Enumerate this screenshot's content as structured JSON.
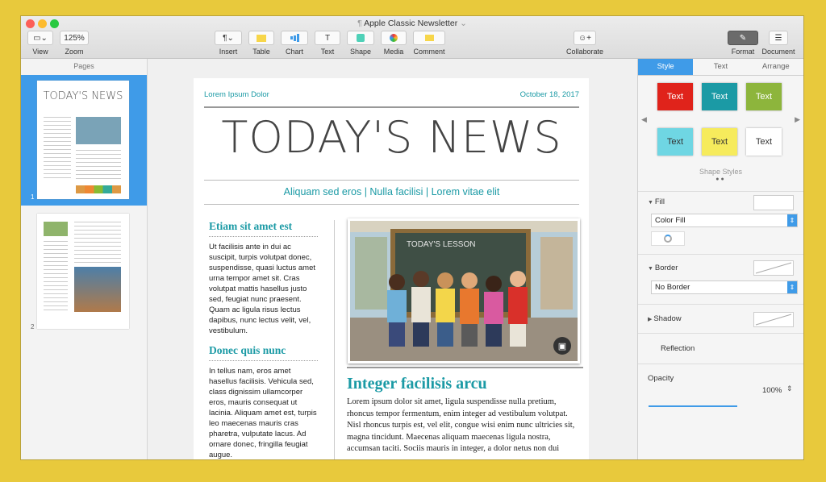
{
  "window": {
    "title": "Apple Classic Newsletter"
  },
  "toolbar": {
    "view_label": "View",
    "zoom_value": "125%",
    "zoom_label": "Zoom",
    "insert_label": "Insert",
    "table_label": "Table",
    "chart_label": "Chart",
    "text_label": "Text",
    "shape_label": "Shape",
    "media_label": "Media",
    "comment_label": "Comment",
    "collaborate_label": "Collaborate",
    "format_label": "Format",
    "document_label": "Document"
  },
  "sidebar": {
    "title": "Pages",
    "pages": [
      {
        "number": "1",
        "thumb_title": "TODAY'S NEWS"
      },
      {
        "number": "2"
      }
    ]
  },
  "document": {
    "header_left": "Lorem Ipsum Dolor",
    "header_right": "October 18, 2017",
    "headline": "TODAY'S NEWS",
    "tagline": "Aliquam sed eros | Nulla facilisi | Lorem vitae elit",
    "section1_title": "Etiam sit amet est",
    "section1_body": "Ut facilisis ante in dui ac suscipit, turpis volutpat donec, suspendisse, quasi luctus amet urna tempor amet sit. Cras volutpat mattis hasellus justo sed, feugiat nunc praesent. Quam ac ligula risus lectus dapibus, nunc lectus velit, vel, vestibulum.",
    "section2_title": "Donec quis nunc",
    "section2_body": "In tellus nam, eros amet hasellus facilisis. Vehicula sed, class dignissim ullamcorper eros, mauris consequat ut lacinia. Aliquam amet est, turpis leo maecenas mauris cras pharetra, vulputate lacus. Ad ornare donec, fringilla feugiat augue.",
    "feature_title": "Integer facilisis arcu",
    "feature_body": "Lorem ipsum dolor sit amet, ligula suspendisse nulla pretium, rhoncus tempor fermentum, enim integer ad vestibulum volutpat. Nisl rhoncus turpis est, vel elit, congue wisi enim nunc ultricies sit, magna tincidunt. Maecenas aliquam maecenas ligula nostra, accumsan taciti. Sociis mauris in integer, a dolor netus non dui",
    "chalkboard_text": "TODAY'S LESSON"
  },
  "inspector": {
    "tabs": [
      "Style",
      "Text",
      "Arrange"
    ],
    "swatches": [
      {
        "label": "Text",
        "bg": "#e0231b",
        "fg": "#ffffff"
      },
      {
        "label": "Text",
        "bg": "#1b9aa5",
        "fg": "#ffffff"
      },
      {
        "label": "Text",
        "bg": "#8db53c",
        "fg": "#ffffff"
      },
      {
        "label": "Text",
        "bg": "#6fd6e3",
        "fg": "#333333"
      },
      {
        "label": "Text",
        "bg": "#f6eb5c",
        "fg": "#333333"
      },
      {
        "label": "Text",
        "bg": "#ffffff",
        "fg": "#333333"
      }
    ],
    "shape_styles_label": "Shape Styles",
    "fill_label": "Fill",
    "fill_type": "Color Fill",
    "border_label": "Border",
    "border_type": "No Border",
    "shadow_label": "Shadow",
    "reflection_label": "Reflection",
    "opacity_label": "Opacity",
    "opacity_value": "100%"
  }
}
